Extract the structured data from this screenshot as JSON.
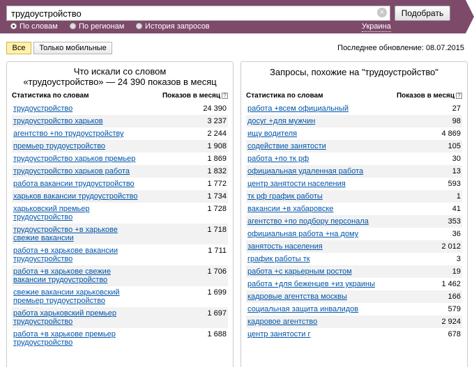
{
  "search": {
    "query": "трудоустройство",
    "clear_icon": "clear-icon",
    "button": "Подобрать"
  },
  "modes": [
    {
      "label": "По словам",
      "selected": true
    },
    {
      "label": "По регионам",
      "selected": false
    },
    {
      "label": "История запросов",
      "selected": false
    }
  ],
  "region": "Украина",
  "filters": [
    {
      "label": "Все",
      "active": true
    },
    {
      "label": "Только мобильные",
      "active": false
    }
  ],
  "last_update": "Последнее обновление: 08.07.2015",
  "left": {
    "title": "Что искали со словом",
    "subtitle": "«трудоустройство» — 24 390 показов в месяц",
    "col_words": "Статистика по словам",
    "col_count": "Показов в месяц",
    "help": "?",
    "rows": [
      {
        "w": "трудоустройство",
        "n": "24 390"
      },
      {
        "w": "трудоустройство харьков",
        "n": "3 237"
      },
      {
        "w": "агентство +по трудоустройству",
        "n": "2 244"
      },
      {
        "w": "премьер трудоустройство",
        "n": "1 908"
      },
      {
        "w": "трудоустройство харьков премьер",
        "n": "1 869"
      },
      {
        "w": "трудоустройство харьков работа",
        "n": "1 832"
      },
      {
        "w": "работа вакансии трудоустройство",
        "n": "1 772"
      },
      {
        "w": "харьков вакансии трудоустройство",
        "n": "1 734"
      },
      {
        "w": "харьковский премьер трудоустройство",
        "n": "1 728"
      },
      {
        "w": "трудоустройство +в харькове свежие вакансии",
        "n": "1 718"
      },
      {
        "w": "работа +в харькове вакансии трудоустройство",
        "n": "1 711"
      },
      {
        "w": "работа +в харькове свежие вакансии трудоустройство",
        "n": "1 706"
      },
      {
        "w": "свежие вакансии харьковский премьер трудоустройство",
        "n": "1 699"
      },
      {
        "w": "работа харьковский премьер трудоустройство",
        "n": "1 697"
      },
      {
        "w": "работа +в харькове премьер трудоустройство",
        "n": "1 688"
      }
    ]
  },
  "right": {
    "title": "Запросы, похожие на \"трудоустройство\"",
    "col_words": "Статистика по словам",
    "col_count": "Показов в месяц",
    "help": "?",
    "rows": [
      {
        "w": "работа +всем официальный",
        "n": "27"
      },
      {
        "w": "досуг +для мужчин",
        "n": "98"
      },
      {
        "w": "ищу водителя",
        "n": "4 869"
      },
      {
        "w": "содействие занятости",
        "n": "105"
      },
      {
        "w": "работа +по тк рф",
        "n": "30"
      },
      {
        "w": "официальная удаленная работа",
        "n": "13"
      },
      {
        "w": "центр занятости населения",
        "n": "593"
      },
      {
        "w": "тк рф график работы",
        "n": "1"
      },
      {
        "w": "вакансии +в хабаровске",
        "n": "41"
      },
      {
        "w": "агентство +по подбору персонала",
        "n": "353"
      },
      {
        "w": "официальная работа +на дому",
        "n": "36"
      },
      {
        "w": "занятость населения",
        "n": "2 012"
      },
      {
        "w": "график работы тк",
        "n": "3"
      },
      {
        "w": "работа +с карьерным ростом",
        "n": "19"
      },
      {
        "w": "работа +для беженцев +из украины",
        "n": "1 462"
      },
      {
        "w": "кадровые агентства москвы",
        "n": "166"
      },
      {
        "w": "социальная защита инвалидов",
        "n": "579"
      },
      {
        "w": "кадровое агентство",
        "n": "2 924"
      },
      {
        "w": "центр занятости г",
        "n": "678"
      }
    ]
  }
}
